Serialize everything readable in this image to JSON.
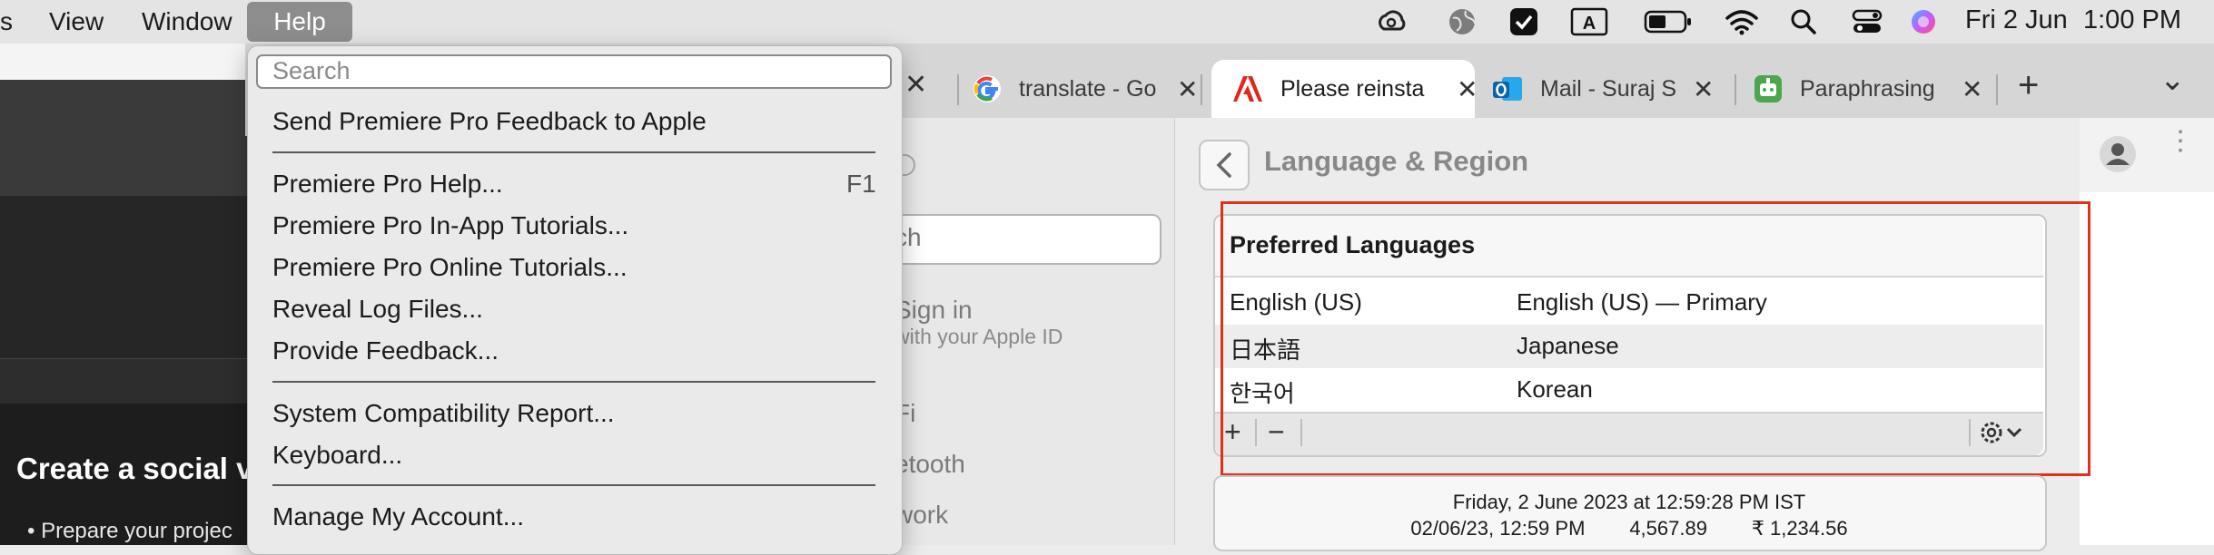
{
  "menubar": {
    "items": [
      "s",
      "View",
      "Window",
      "Help"
    ],
    "date": "Fri 2 Jun",
    "time": "1:00 PM",
    "icons": [
      "creative-cloud-icon",
      "globe-icon",
      "checkmark-icon",
      "keyboard-input-a-icon",
      "battery-icon",
      "wifi-icon",
      "search-icon",
      "control-center-icon",
      "siri-icon"
    ]
  },
  "help_menu": {
    "search_placeholder": "Search",
    "items": [
      {
        "label": "Send Premiere Pro Feedback to Apple",
        "shortcut": ""
      },
      {
        "label": "Premiere Pro Help...",
        "shortcut": "F1"
      },
      {
        "label": "Premiere Pro In-App Tutorials...",
        "shortcut": ""
      },
      {
        "label": "Premiere Pro Online Tutorials...",
        "shortcut": ""
      },
      {
        "label": "Reveal Log Files...",
        "shortcut": ""
      },
      {
        "label": "Provide Feedback...",
        "shortcut": ""
      },
      {
        "label": "System Compatibility Report...",
        "shortcut": ""
      },
      {
        "label": "Keyboard...",
        "shortcut": ""
      },
      {
        "label": "Manage My Account...",
        "shortcut": ""
      }
    ]
  },
  "browser": {
    "tabs": [
      {
        "label": "translate - Go",
        "icon": "google-icon"
      },
      {
        "label": "Please reinsta",
        "icon": "adobe-icon",
        "active": true
      },
      {
        "label": "Mail - Suraj S",
        "icon": "outlook-icon"
      },
      {
        "label": "Paraphrasing",
        "icon": "robot-icon"
      }
    ],
    "new_tab": "+",
    "tab_list": "⌄"
  },
  "left_app": {
    "heading": "Create a social vic",
    "bullet": "Prepare your projec"
  },
  "settings": {
    "sidebar": {
      "search_text": "ch",
      "sign_in": "Sign in",
      "sign_in_sub": "with your Apple ID",
      "items": [
        "Fi",
        "etooth",
        "work"
      ]
    },
    "title": "Language & Region",
    "preferred_languages": {
      "title": "Preferred Languages",
      "rows": [
        {
          "native": "English (US)",
          "english": "English (US) — Primary"
        },
        {
          "native": "日本語",
          "english": "Japanese"
        },
        {
          "native": "한국어",
          "english": "Korean"
        }
      ],
      "add": "+",
      "remove": "−"
    },
    "date_sample": {
      "line1": "Friday, 2 June 2023 at 12:59:28 PM IST",
      "short_date": "02/06/23, 12:59 PM",
      "number": "4,567.89",
      "currency": "₹ 1,234.56"
    }
  },
  "annotation_color": "#e0301e"
}
